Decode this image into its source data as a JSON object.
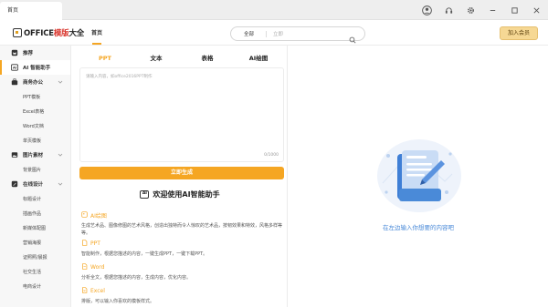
{
  "titlebar": {
    "tab_label": "首页"
  },
  "header": {
    "logo_prefix": "OFFICE",
    "logo_accent": "模版",
    "logo_suffix": "大全",
    "nav_home": "首页",
    "search_category": "全部",
    "search_placeholder": "立即",
    "join_label": "加入会员"
  },
  "sidebar": {
    "items": [
      {
        "label": "推荐",
        "type": "main",
        "icon": "crown-icon"
      },
      {
        "label": "AI 智能助手",
        "type": "main",
        "icon": "ai-icon",
        "active": true
      },
      {
        "label": "商务办公",
        "type": "main",
        "icon": "briefcase-icon",
        "chevron": true
      },
      {
        "label": "PPT模板",
        "type": "sub"
      },
      {
        "label": "Excel表格",
        "type": "sub"
      },
      {
        "label": "Word文档",
        "type": "sub"
      },
      {
        "label": "单页模板",
        "type": "sub"
      },
      {
        "label": "图片素材",
        "type": "main",
        "icon": "image-icon",
        "chevron": true
      },
      {
        "label": "背景图片",
        "type": "sub"
      },
      {
        "label": "在线设计",
        "type": "main",
        "icon": "design-icon",
        "chevron": true
      },
      {
        "label": "标题设计",
        "type": "sub"
      },
      {
        "label": "插画作品",
        "type": "sub"
      },
      {
        "label": "新媒体配图",
        "type": "sub"
      },
      {
        "label": "营销海报",
        "type": "sub"
      },
      {
        "label": "证照照/晨报",
        "type": "sub"
      },
      {
        "label": "社交生活",
        "type": "sub"
      },
      {
        "label": "电商设计",
        "type": "sub"
      }
    ]
  },
  "mid": {
    "tabs": [
      "PPT",
      "文本",
      "表格",
      "AI绘图"
    ],
    "textarea_placeholder": "请输入内容，如office2016PPT制作",
    "char_count": "0/1000",
    "generate_label": "立即生成",
    "welcome": "欢迎使用AI智能助手",
    "welcome_icon": "AI",
    "features": [
      {
        "title": "AI绘图",
        "desc": "生成艺术品、图像修图的艺术风格，创造出独特而令人惊叹的艺术品，按韧效果和特效，风格多样等等。",
        "icon": "palette-icon"
      },
      {
        "title": "PPT",
        "desc": "智能制作，根据您描述的内容，一键生成PPT，一键下载PPT。",
        "icon": "ppt-icon"
      },
      {
        "title": "Word",
        "desc": "分析全文，根据您描述的内容，生成内容，优化内容。",
        "icon": "word-icon"
      },
      {
        "title": "Excel",
        "desc": "排版，可以输入你喜欢的模板样式。",
        "icon": "excel-icon"
      }
    ]
  },
  "right": {
    "hint": "在左边输入你想要的内容吧"
  },
  "colors": {
    "accent": "#f5a623",
    "hint": "#4a8ad8",
    "logo_red": "#d9342b"
  }
}
